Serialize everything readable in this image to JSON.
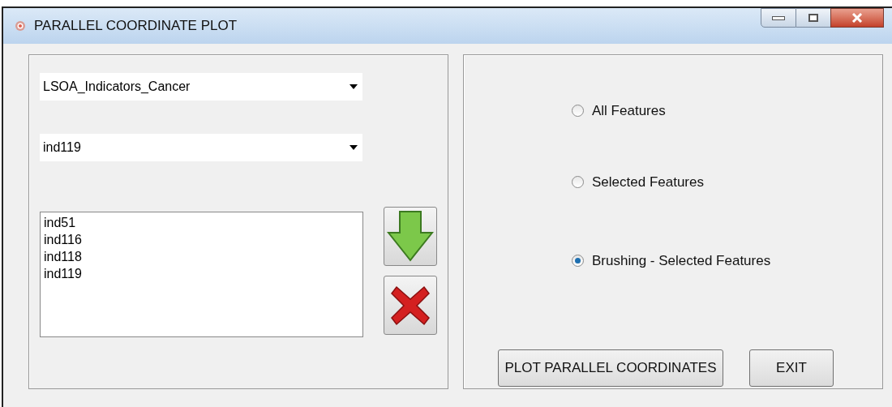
{
  "window": {
    "title": "PARALLEL COORDINATE PLOT"
  },
  "dropdowns": [
    {
      "value": "LSOA_Indicators_Cancer"
    },
    {
      "value": "ind119"
    }
  ],
  "list": {
    "items": [
      "ind51",
      "ind116",
      "ind118",
      "ind119"
    ]
  },
  "options": [
    {
      "label": "All Features",
      "selected": false
    },
    {
      "label": "Selected Features",
      "selected": false
    },
    {
      "label": "Brushing - Selected Features",
      "selected": true
    }
  ],
  "buttons": [
    "PLOT PARALLEL COORDINATES",
    "EXIT"
  ]
}
